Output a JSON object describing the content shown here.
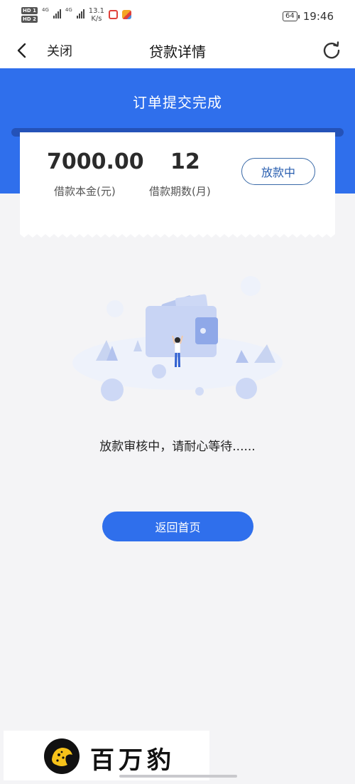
{
  "status_bar": {
    "hd1": "HD 1",
    "hd2": "HD 2",
    "network1": "4G",
    "network2": "4G",
    "speed_value": "13.1",
    "speed_unit": "K/s",
    "battery": "64",
    "time": "19:46"
  },
  "nav": {
    "close_label": "关闭",
    "title": "贷款详情"
  },
  "header": {
    "order_status": "订单提交完成"
  },
  "loan": {
    "amount": "7000.00",
    "amount_label": "借款本金(元)",
    "term": "12",
    "term_label": "借款期数(月)",
    "status": "放款中"
  },
  "message": "放款审核中，请耐心等待......",
  "actions": {
    "home_button": "返回首页"
  },
  "watermark": {
    "text": "百万豹"
  },
  "colors": {
    "primary": "#2f6fec",
    "header_slot": "#2452b8",
    "status_border": "#3a6aa8",
    "background": "#f4f4f6"
  }
}
